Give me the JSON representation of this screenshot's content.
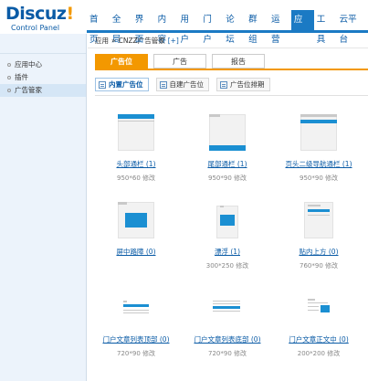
{
  "logo": {
    "brand": "Discuz",
    "bang": "!",
    "subtitle": "Control Panel"
  },
  "topnav": {
    "items": [
      {
        "label": "首页"
      },
      {
        "label": "全局"
      },
      {
        "label": "界面"
      },
      {
        "label": "内容"
      },
      {
        "label": "用户"
      },
      {
        "label": "门户"
      },
      {
        "label": "论坛"
      },
      {
        "label": "群组"
      },
      {
        "label": "运营"
      },
      {
        "label": "应用",
        "active": true
      },
      {
        "label": "工具"
      },
      {
        "label": "云平台"
      }
    ],
    "accent": "#1b7ac4"
  },
  "sidebar": {
    "items": [
      {
        "label": "应用中心"
      },
      {
        "label": "插件"
      },
      {
        "label": "广告管家",
        "active": true
      }
    ]
  },
  "breadcrumb": {
    "part1": "应用",
    "sep": "»",
    "part2": "CNZZ广告管家",
    "add": "[+]"
  },
  "tabs": [
    {
      "label": "广告位",
      "active": true
    },
    {
      "label": "广告"
    },
    {
      "label": "报告"
    }
  ],
  "subtabs": [
    {
      "label": "内置广告位",
      "active": true
    },
    {
      "label": "自建广告位"
    },
    {
      "label": "广告位排期"
    }
  ],
  "ad_slots": [
    {
      "name": "头部通栏 (1)",
      "meta": "950*60 修改",
      "icon": "banner-top-icon"
    },
    {
      "name": "尾部通栏 (1)",
      "meta": "950*90 修改",
      "icon": "banner-bottom-icon"
    },
    {
      "name": "页头二级导航通栏 (1)",
      "meta": "950*90 修改",
      "icon": "subnav-banner-icon"
    },
    {
      "name": "屏中路障 (0)",
      "meta": "",
      "icon": "screen-center-icon"
    },
    {
      "name": "漂浮 (1)",
      "meta": "300*250 修改",
      "icon": "float-icon"
    },
    {
      "name": "贴内上方 (0)",
      "meta": "760*90 修改",
      "icon": "post-top-icon"
    },
    {
      "name": "门户文章列表顶部 (0)",
      "meta": "720*90 修改",
      "icon": "portal-list-top-icon"
    },
    {
      "name": "门户文章列表底部 (0)",
      "meta": "720*90 修改",
      "icon": "portal-list-bottom-icon"
    },
    {
      "name": "门户文章正文中 (0)",
      "meta": "200*200 修改",
      "icon": "portal-article-middle-icon"
    }
  ],
  "colors": {
    "orange": "#f39800",
    "blue": "#1b8fd2",
    "link": "#0a5ba6"
  }
}
